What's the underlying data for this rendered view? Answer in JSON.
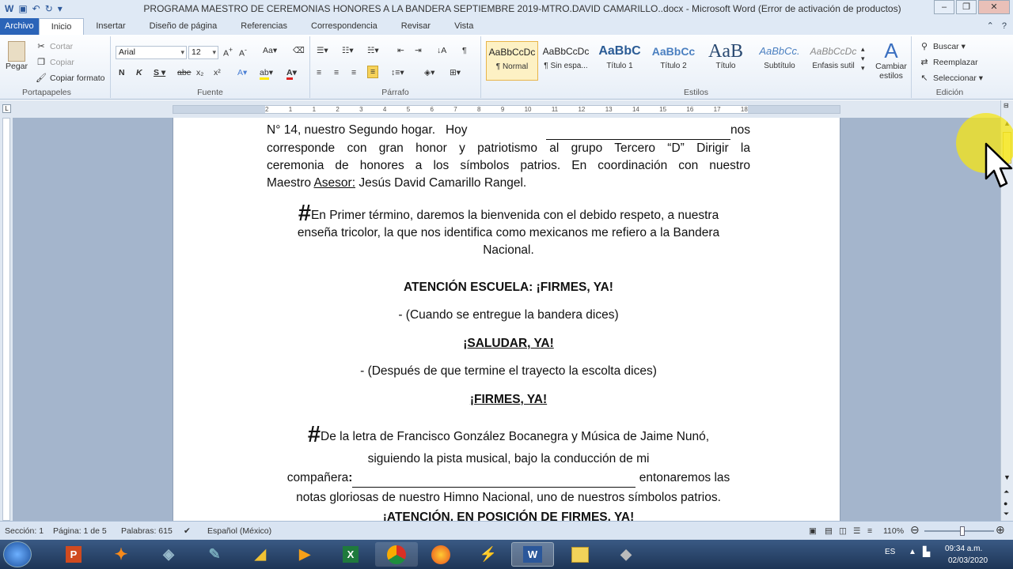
{
  "window": {
    "title": "PROGRAMA MAESTRO DE CEREMONIAS HONORES A LA BANDERA SEPTIEMBRE 2019-MTRO.DAVID CAMARILLO..docx  -  Microsoft Word (Error de activación de productos)"
  },
  "tabs": [
    "Archivo",
    "Inicio",
    "Insertar",
    "Diseño de página",
    "Referencias",
    "Correspondencia",
    "Revisar",
    "Vista"
  ],
  "clipboard": {
    "paste": "Pegar",
    "cut": "Cortar",
    "copy": "Copiar",
    "format_painter": "Copiar formato",
    "label": "Portapapeles"
  },
  "font": {
    "name": "Arial",
    "size": "12",
    "label": "Fuente"
  },
  "paragraph": {
    "label": "Párrafo"
  },
  "styles": {
    "label": "Estilos",
    "change": "Cambiar estilos",
    "items": [
      {
        "sample": "AaBbCcDc",
        "name": "¶ Normal"
      },
      {
        "sample": "AaBbCcDc",
        "name": "¶ Sin espa..."
      },
      {
        "sample": "AaBbC",
        "name": "Título 1"
      },
      {
        "sample": "AaBbCc",
        "name": "Título 2"
      },
      {
        "sample": "AaB",
        "name": "Título"
      },
      {
        "sample": "AaBbCc.",
        "name": "Subtítulo"
      },
      {
        "sample": "AaBbCcDc",
        "name": "Énfasis sutil"
      }
    ]
  },
  "editing": {
    "find": "Buscar",
    "replace": "Reemplazar",
    "select": "Seleccionar",
    "label": "Edición"
  },
  "ruler": {
    "ticks": [
      "2",
      "1",
      "1",
      "2",
      "3",
      "4",
      "5",
      "6",
      "7",
      "8",
      "9",
      "10",
      "11",
      "12",
      "13",
      "14",
      "15",
      "16",
      "17",
      "18"
    ]
  },
  "document": {
    "p1_line1_a": "N° 14, nuestro Segundo hogar.   Hoy",
    "p1_line1_b": "nos",
    "p1_line2": "corresponde con gran honor y patriotismo al grupo Tercero “D”  Dirigir la",
    "p1_line3": "ceremonia de honores a los símbolos patrios. En coordinación con nuestro",
    "p1_line4_a": "Maestro ",
    "p1_line4_b": "Asesor:",
    "p1_line4_c": " Jesús David Camarillo Rangel.",
    "hash": "#",
    "p2_line1": "En Primer término, daremos la bienvenida con el debido respeto, a nuestra",
    "p2_line2": "enseña tricolor, la que nos identifica como mexicanos me refiero a la Bandera",
    "p2_line3": "Nacional.",
    "cmd1": "ATENCIÓN ESCUELA: ¡FIRMES, YA!",
    "note1": "-    (Cuando se entregue la bandera dices)",
    "cmd2": "¡SALUDAR, YA!",
    "note2": "-    (Después de que termine el trayecto la escolta dices)",
    "cmd3": "¡FIRMES, YA!",
    "p3_line1": "De la letra de Francisco González Bocanegra y Música de Jaime Nunó,",
    "p3_line2": "siguiendo la pista musical, bajo la conducción de mi",
    "p3_line3_a": "compañera",
    "p3_line3_colon": ":",
    "p3_line3_b": " entonaremos las",
    "p3_line4": "notas gloriosas de nuestro Himno Nacional, uno de nuestros símbolos patrios.",
    "cmd4": "¡ATENCIÓN, EN POSICIÓN DE FIRMES, YA!"
  },
  "status": {
    "section": "Sección: 1",
    "page": "Página: 1 de 5",
    "words": "Palabras: 615",
    "language": "Español (México)",
    "zoom": "110%",
    "zoom_level": 0.55
  },
  "taskbar": {
    "lang": "ES",
    "time": "09:34 a.m.",
    "date": "02/03/2020"
  }
}
